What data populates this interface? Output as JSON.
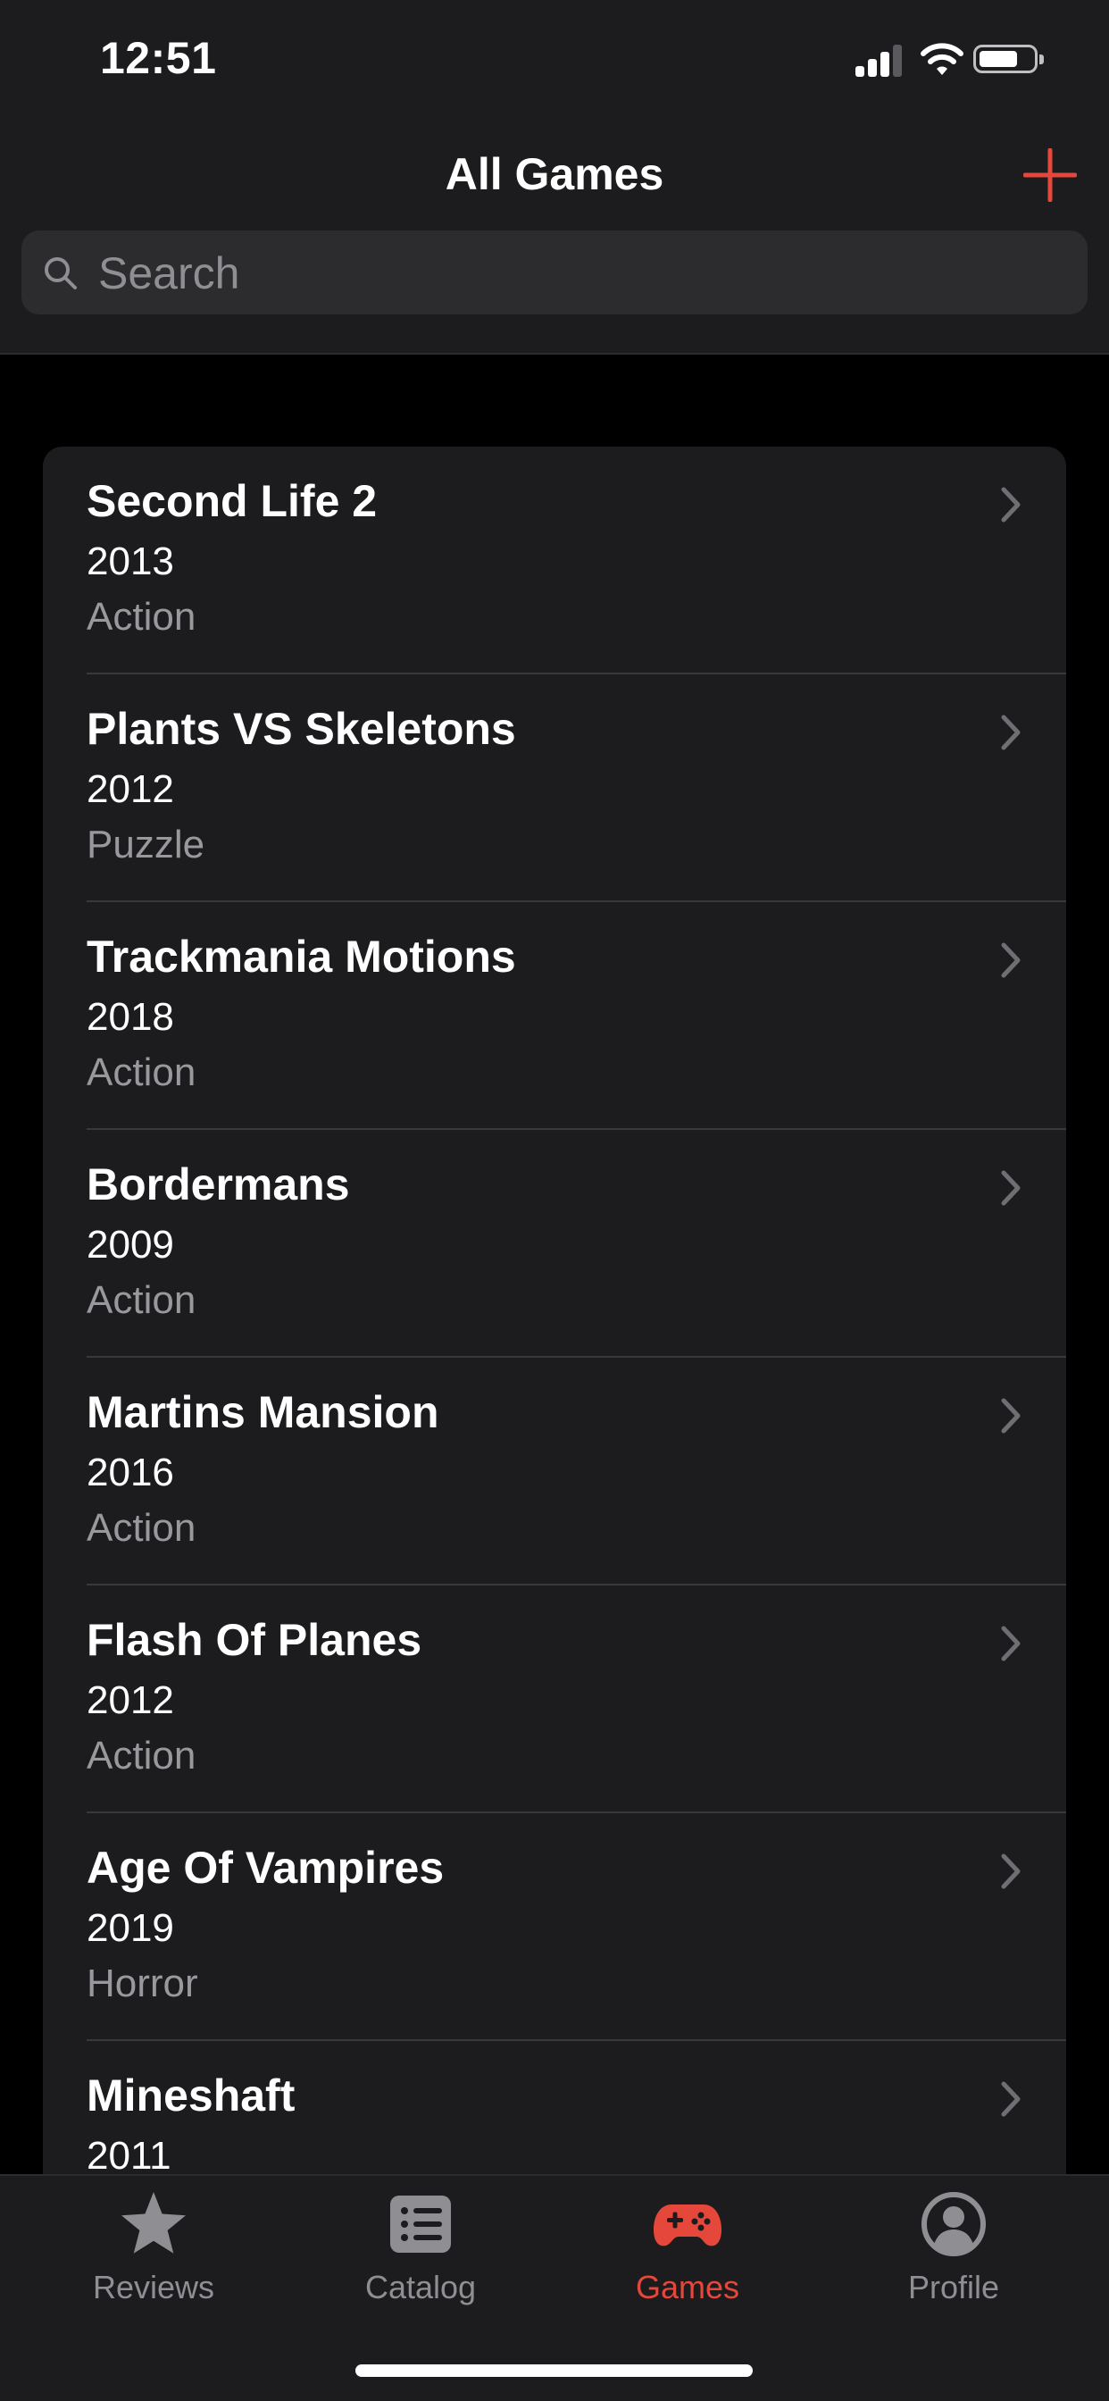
{
  "status_bar": {
    "time": "12:51"
  },
  "header": {
    "title": "All Games"
  },
  "search": {
    "placeholder": "Search",
    "value": ""
  },
  "colors": {
    "accent": "#e5473b",
    "background": "#000000",
    "surface": "#1c1c1e",
    "secondary_text": "#98989d"
  },
  "games": [
    {
      "name": "Second Life 2",
      "year": "2013",
      "genre": "Action"
    },
    {
      "name": "Plants VS Skeletons",
      "year": "2012",
      "genre": "Puzzle"
    },
    {
      "name": "Trackmania Motions",
      "year": "2018",
      "genre": "Action"
    },
    {
      "name": "Bordermans",
      "year": "2009",
      "genre": "Action"
    },
    {
      "name": "Martins Mansion",
      "year": "2016",
      "genre": "Action"
    },
    {
      "name": "Flash Of Planes",
      "year": "2012",
      "genre": "Action"
    },
    {
      "name": "Age Of Vampires",
      "year": "2019",
      "genre": "Horror"
    },
    {
      "name": "Mineshaft",
      "year": "2011",
      "genre": ""
    }
  ],
  "tabs": [
    {
      "label": "Reviews",
      "icon": "star-icon",
      "active": false
    },
    {
      "label": "Catalog",
      "icon": "list-icon",
      "active": false
    },
    {
      "label": "Games",
      "icon": "gamepad-icon",
      "active": true
    },
    {
      "label": "Profile",
      "icon": "person-circle-icon",
      "active": false
    }
  ]
}
